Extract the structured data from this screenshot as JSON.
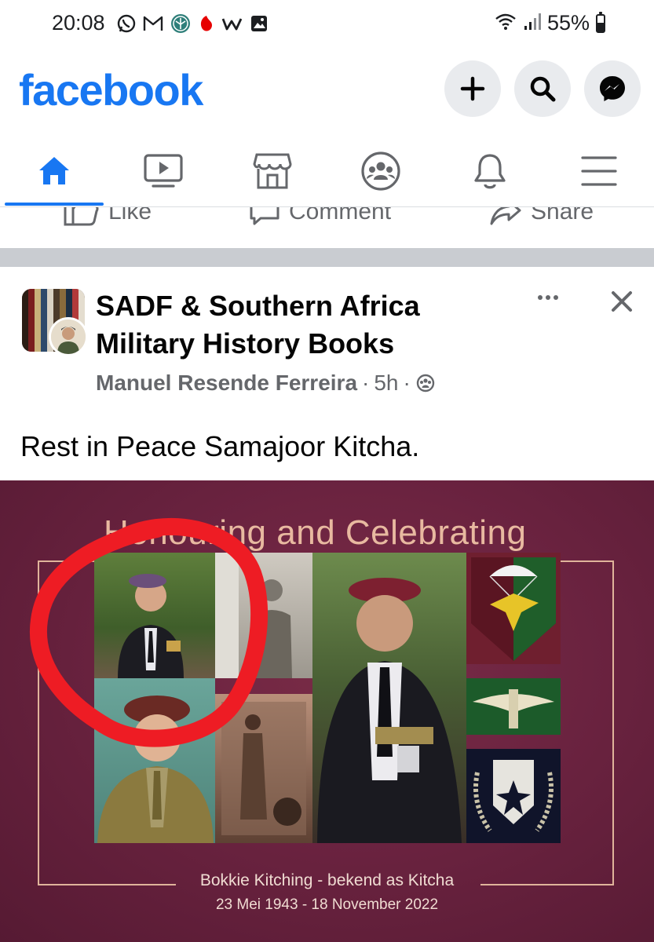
{
  "status_bar": {
    "time": "20:08",
    "battery_percent": "55%",
    "battery_level": 0.55,
    "left_icons": [
      "whatsapp-icon",
      "gmail-icon",
      "app-icon",
      "vodafone-icon",
      "w-app-icon",
      "gallery-icon"
    ],
    "right_icons": [
      "wifi-icon",
      "signal-icon",
      "battery-icon"
    ]
  },
  "header": {
    "logo": "facebook",
    "buttons": [
      "plus-icon",
      "search-icon",
      "messenger-icon"
    ],
    "accent_color": "#1877f2"
  },
  "nav": {
    "tabs": [
      "home",
      "video",
      "marketplace",
      "groups",
      "notifications",
      "menu"
    ],
    "active_tab": "home"
  },
  "actions": {
    "like": "Like",
    "comment": "Comment",
    "share": "Share"
  },
  "post": {
    "group_name": "SADF & Southern Africa Military History Books",
    "author": "Manuel Resende Ferreira",
    "sep1": " · ",
    "time": "5h",
    "sep2": " · ",
    "text": "Rest in Peace Samajoor Kitcha."
  },
  "memorial": {
    "title": "Honouring and Celebrating",
    "name_line": "Bokkie Kitching - bekend as Kitcha",
    "dates_line": "23 Mei 1943 - 18 November 2022",
    "background_color": "#6b2340",
    "annotation_color": "#ee1c24"
  }
}
